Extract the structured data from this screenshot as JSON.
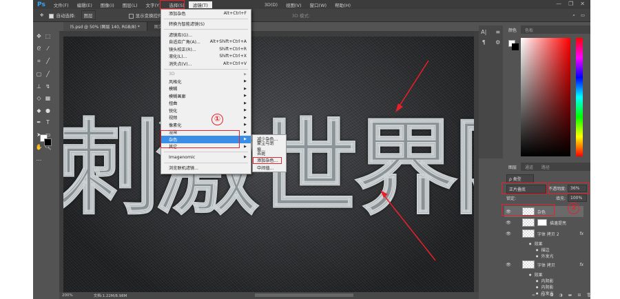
{
  "app": {
    "logo": "Ps"
  },
  "menubar": {
    "items": [
      "文件(F)",
      "编辑(E)",
      "图像(I)",
      "图层(L)",
      "文字(Y)",
      "选择(S)",
      "滤镜(T)",
      "3D(D)",
      "视图(V)",
      "窗口(W)",
      "帮助(H)"
    ],
    "window_controls": [
      "—",
      "❐",
      "✕"
    ]
  },
  "options": {
    "auto_select_label": "自动选择:",
    "auto_select_value": "图层",
    "show_transform": "显示变换控件",
    "mode_3d": "3D 模式:"
  },
  "tabs": [
    {
      "label": "l5.psd @ 50% (图层 140, RGB/8) *"
    },
    {
      "label": "图文特效.p"
    }
  ],
  "canvas": {
    "text": "刺激世界限"
  },
  "status": {
    "zoom": "200%",
    "doc": "文档:1.22M/8.98M"
  },
  "filter_menu": {
    "items": [
      {
        "label": "添加杂色",
        "shortcut": "Alt+Ctrl+F"
      },
      {
        "sep": true
      },
      {
        "label": "转换为智能滤镜(S)"
      },
      {
        "sep": true
      },
      {
        "label": "滤镜库(G)..."
      },
      {
        "label": "自适应广角(A)...",
        "shortcut": "Alt+Shift+Ctrl+A"
      },
      {
        "label": "镜头校正(R)...",
        "shortcut": "Shift+Ctrl+R"
      },
      {
        "label": "液化(L)...",
        "shortcut": "Shift+Ctrl+X"
      },
      {
        "label": "消失点(V)...",
        "shortcut": "Alt+Ctrl+V"
      },
      {
        "sep": true
      },
      {
        "label": "3D",
        "sub": true,
        "disabled": true
      },
      {
        "label": "风格化",
        "sub": true
      },
      {
        "label": "模糊",
        "sub": true
      },
      {
        "label": "模糊画廊",
        "sub": true
      },
      {
        "label": "扭曲",
        "sub": true
      },
      {
        "label": "锐化",
        "sub": true
      },
      {
        "label": "视频",
        "sub": true
      },
      {
        "label": "像素化",
        "sub": true
      },
      {
        "label": "渲染",
        "sub": true
      },
      {
        "label": "杂色",
        "sub": true,
        "highlighted": true
      },
      {
        "label": "其它",
        "sub": true
      },
      {
        "sep": true
      },
      {
        "label": "Imagenomic",
        "sub": true
      },
      {
        "sep": true
      },
      {
        "label": "浏览联机滤镜..."
      }
    ],
    "submenu": [
      "减少杂色...",
      "蒙尘与划痕...",
      "去斑",
      "添加杂色...",
      "中间值..."
    ]
  },
  "annotations": {
    "step1": "①",
    "step2": "②"
  },
  "color_panel": {
    "tabs": [
      "颜色",
      "色板"
    ]
  },
  "layers_panel": {
    "tabs": [
      "图层",
      "通道",
      "路径"
    ],
    "filter": "ρ 类型",
    "blend_mode": "正片叠底",
    "opacity_label": "不透明度:",
    "opacity": "36%",
    "lock_label": "锁定:",
    "fill_label": "填充:",
    "fill": "100%",
    "layers": [
      {
        "name": "杂色",
        "selected": true
      },
      {
        "name": "描邊提亮"
      },
      {
        "name": "字体 拷贝 2",
        "fx": "fx"
      },
      {
        "name": "效果",
        "sub": 1
      },
      {
        "name": "描边",
        "sub": 2
      },
      {
        "name": "外发光",
        "sub": 2
      },
      {
        "name": "字体 拷贝",
        "fx": "fx"
      },
      {
        "name": "效果",
        "sub": 1
      },
      {
        "name": "内阴影",
        "sub": 2
      },
      {
        "name": "内阴影",
        "sub": 2
      },
      {
        "name": "内发光",
        "sub": 2
      }
    ]
  },
  "colors": {
    "accent": "#3a8ee6",
    "annotation": "#e8202a"
  }
}
